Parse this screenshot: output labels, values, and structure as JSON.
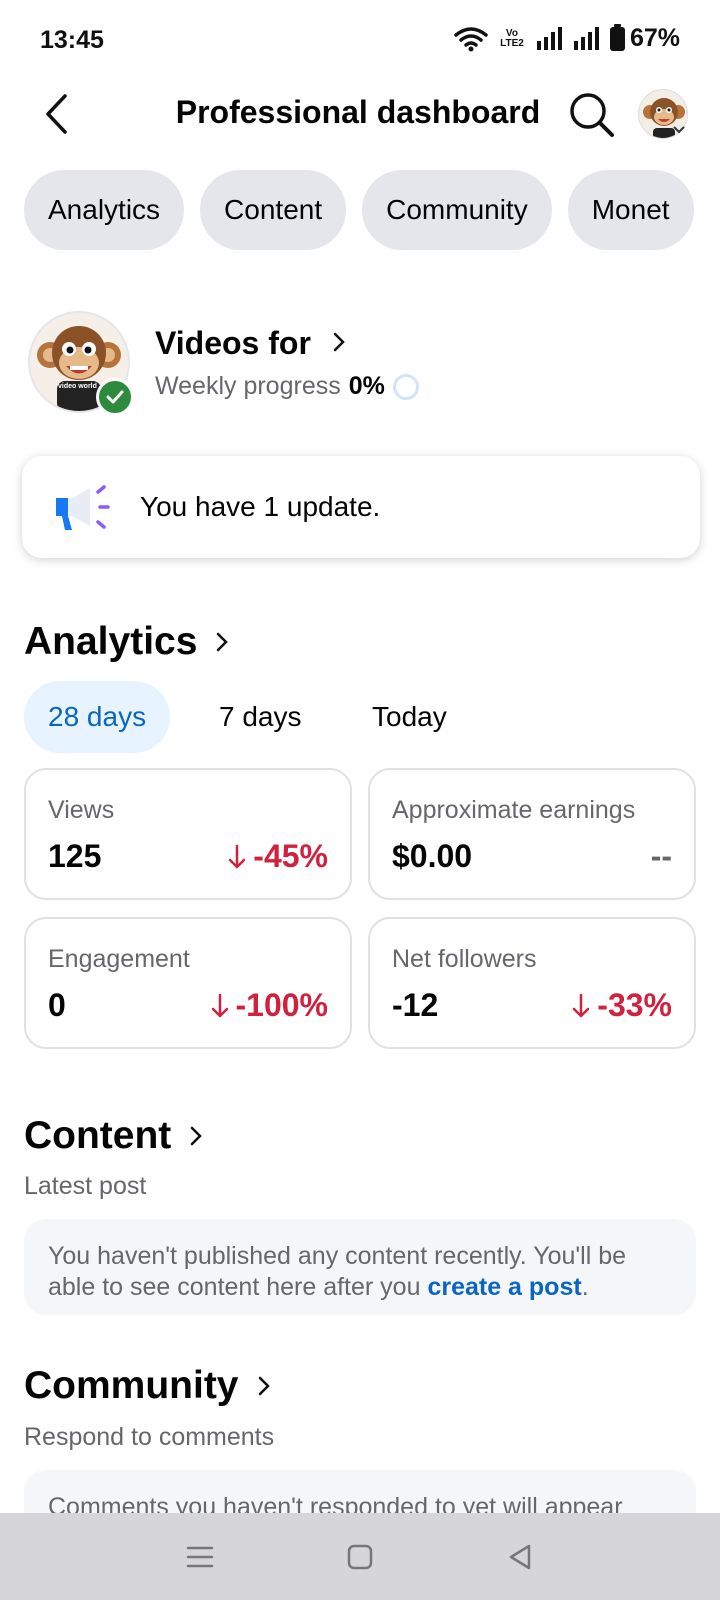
{
  "status_bar": {
    "time": "13:45",
    "volte_top": "Vo",
    "volte_bottom": "LTE2",
    "battery": "67%",
    "icons": [
      "wifi-icon",
      "volte-icon",
      "signal-icon",
      "signal-icon",
      "battery-icon"
    ]
  },
  "header": {
    "title": "Professional dashboard",
    "back_icon": "chevron-left-icon",
    "search_icon": "search-icon"
  },
  "tabs": [
    {
      "label": "Analytics"
    },
    {
      "label": "Content"
    },
    {
      "label": "Community"
    },
    {
      "label": "Monet"
    }
  ],
  "profile": {
    "name": "Videos for",
    "progress_label": "Weekly progress",
    "progress_value": "0%",
    "avatar_caption": "video world",
    "progress_fraction": 0
  },
  "update_card": {
    "text": "You have 1 update.",
    "icon": "megaphone-icon"
  },
  "analytics": {
    "title": "Analytics",
    "ranges": [
      {
        "label": "28 days",
        "active": true
      },
      {
        "label": "7 days",
        "active": false
      },
      {
        "label": "Today",
        "active": false
      }
    ],
    "metrics": [
      {
        "label": "Views",
        "value": "125",
        "change": "-45%"
      },
      {
        "label": "Approximate earnings",
        "value": "$0.00",
        "change": "--"
      },
      {
        "label": "Engagement",
        "value": "0",
        "change": "-100%"
      },
      {
        "label": "Net followers",
        "value": "-12",
        "change": "-33%"
      }
    ]
  },
  "content": {
    "title": "Content",
    "subtitle": "Latest post",
    "message_line1": "You haven't published any content recently. You'll be",
    "message_line2": "able to see content here after you",
    "link": "create a post",
    "period": "."
  },
  "community": {
    "title": "Community",
    "subtitle": "Respond to comments",
    "message": "Comments you haven't responded to yet will appear"
  },
  "nav_bar": {
    "items": [
      "menu-icon",
      "home-icon",
      "back-icon"
    ]
  },
  "colors": {
    "accent_blue": "#0a66c2",
    "negative_red": "#d0223e",
    "verified_green": "#2e8b3e",
    "chip_gray": "#e4e6eb"
  }
}
